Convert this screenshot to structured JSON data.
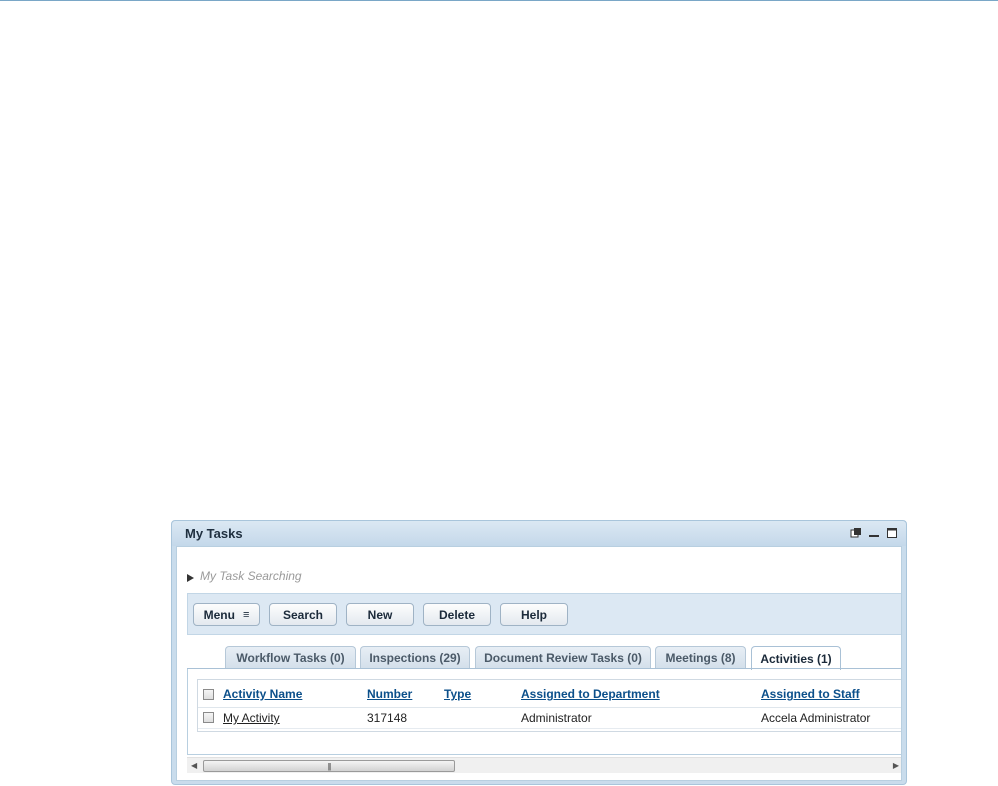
{
  "portlet": {
    "title": "My Tasks",
    "tools": [
      "popout-icon",
      "minimize-icon",
      "maximize-icon"
    ]
  },
  "search_toggle": {
    "label": "My Task Searching"
  },
  "toolbar": {
    "menu_label": "Menu",
    "search_label": "Search",
    "new_label": "New",
    "delete_label": "Delete",
    "help_label": "Help"
  },
  "tabs": [
    {
      "label": "Workflow Tasks (0)",
      "active": false
    },
    {
      "label": "Inspections (29)",
      "active": false
    },
    {
      "label": "Document Review Tasks (0)",
      "active": false
    },
    {
      "label": "Meetings (8)",
      "active": false
    },
    {
      "label": "Activities (1)",
      "active": true
    }
  ],
  "grid": {
    "columns": [
      "Activity Name",
      "Number",
      "Type",
      "Assigned to Department",
      "Assigned to Staff"
    ],
    "rows": [
      {
        "activity_name": "My Activity",
        "number": "317148",
        "type": "",
        "department": "Administrator",
        "staff": "Accela Administrator"
      }
    ]
  },
  "colors": {
    "header_bg": "#c9dcec",
    "toolbar_bg": "#dce8f3",
    "link": "#0b4f8a"
  }
}
